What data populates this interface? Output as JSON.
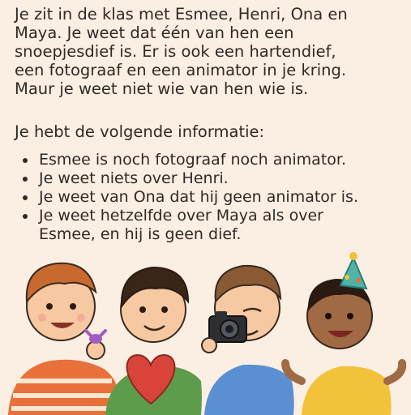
{
  "intro_lines": [
    "Je zit in de klas met Esmee, Henri, Ona en",
    "Maya. Je weet dat één van hen een",
    "snoepjesdief is. Er is ook een hartendief,",
    "een fotograaf en een animator in je kring.",
    "Maur je weet niet wie van hen wie is."
  ],
  "info_heading": "Je hebt de volgende informatie:",
  "facts": [
    "Esmee is noch fotograaf noch animator.",
    "Je weet niets over Henri.",
    "Je weet van Ona dat hij geen animator is.",
    "Je weet hetzelfde over Maya als over",
    "Esmee, en hij is geen dief."
  ],
  "colors": {
    "background": "#fbeee2",
    "text": "#2f2a26",
    "kid1_shirt": "#e8703a",
    "kid2_shirt": "#5d9c4b",
    "kid3_shirt": "#5b8fd1",
    "kid4_shirt": "#f1c23a",
    "heart": "#d9443a",
    "candy": "#a45bbf",
    "party_hat": "#4fb3a8"
  },
  "illustration": {
    "figures": [
      "kid-with-candy",
      "kid-with-heart",
      "kid-with-camera",
      "kid-with-party-hat"
    ]
  }
}
